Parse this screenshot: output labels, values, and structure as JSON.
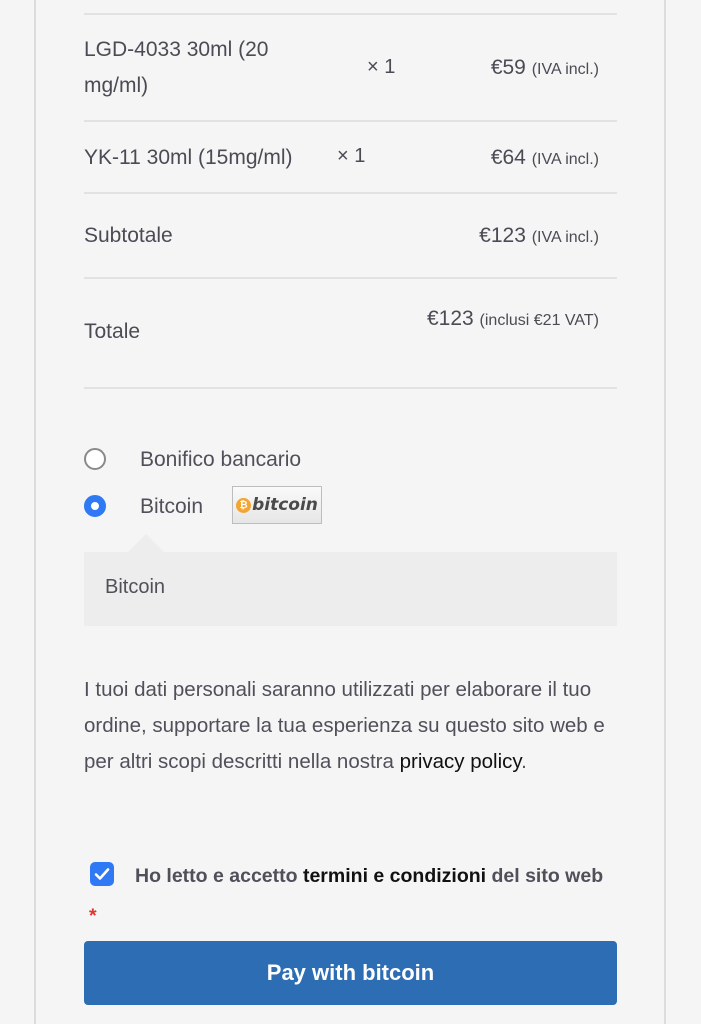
{
  "order": {
    "items": [
      {
        "name": "LGD-4033 30ml (20 mg/ml)",
        "qty": "× 1",
        "price": "€59",
        "tax_note": "(IVA incl.)"
      },
      {
        "name": "YK-11 30ml (15mg/ml)",
        "qty": "× 1",
        "price": "€64",
        "tax_note": "(IVA incl.)"
      }
    ],
    "subtotal": {
      "label": "Subtotale",
      "value": "€123",
      "tax_note": "(IVA incl.)"
    },
    "total": {
      "label": "Totale",
      "value": "€123",
      "tax_note": "(inclusi €21 VAT)"
    }
  },
  "payment": {
    "methods": [
      {
        "label": "Bonifico bancario",
        "selected": false
      },
      {
        "label": "Bitcoin",
        "selected": true,
        "logo_text": "bitcoin",
        "logo_icon": "bitcoin-coin-icon"
      }
    ],
    "description": "Bitcoin"
  },
  "privacy": {
    "text": "I tuoi dati personali saranno utilizzati per elaborare il tuo ordine, supportare la tua esperienza su questo sito web e per altri scopi descritti nella nostra",
    "link": "privacy policy",
    "end": "."
  },
  "terms": {
    "checked": true,
    "prefix": "Ho letto e accetto",
    "link": "termini e condizioni",
    "suffix": "del sito web",
    "required_marker": "*"
  },
  "pay_button": {
    "label": "Pay with bitcoin"
  },
  "colors": {
    "accent": "#2f7af4",
    "button": "#2d6db4",
    "required": "#e2342f"
  }
}
